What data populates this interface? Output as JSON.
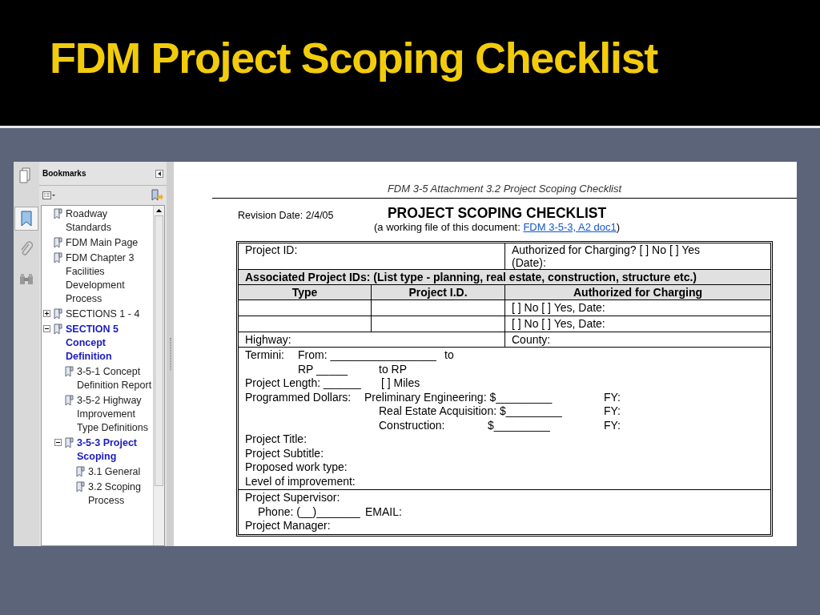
{
  "slide_title": "FDM Project Scoping Checklist",
  "sidebar": {
    "tabs": [
      {
        "kind": "pages",
        "selected": false
      },
      {
        "kind": "bookmarks",
        "selected": true
      },
      {
        "kind": "attachments",
        "selected": false
      },
      {
        "kind": "search",
        "selected": false
      }
    ],
    "panel_title": "Bookmarks",
    "bookmarks": [
      {
        "label": "Roadway Standards",
        "highlighted": false
      },
      {
        "label": "FDM Main Page",
        "highlighted": false
      },
      {
        "label": "FDM Chapter 3 Facilities Development Process",
        "highlighted": false
      },
      {
        "label": "SECTIONS 1 - 4",
        "expanded": false,
        "highlighted": false
      },
      {
        "label": "SECTION 5 Concept Definition",
        "expanded": true,
        "highlighted": true,
        "children": [
          {
            "label": "3-5-1  Concept Definition Report",
            "highlighted": false
          },
          {
            "label": "3-5-2  Highway Improvement Type Definitions",
            "highlighted": false
          },
          {
            "label": "3-5-3  Project Scoping",
            "expanded": true,
            "highlighted": true,
            "children": [
              {
                "label": "3.1  General",
                "highlighted": false
              },
              {
                "label": "3.2  Scoping Process",
                "highlighted": false
              }
            ]
          }
        ]
      }
    ]
  },
  "document": {
    "running_header": "FDM 3-5 Attachment 3.2  Project Scoping Checklist",
    "revision_date": "Revision Date: 2/4/05",
    "title": "PROJECT SCOPING CHECKLIST",
    "subtitle": "(a working file of this document: ",
    "subtitle_link": "FDM 3-5-3, A2 doc1",
    "subtitle_end": ")",
    "table": {
      "project_id": "Project ID:",
      "authorized": "Authorized for Charging? [ ] No  [ ] Yes (Date):",
      "associated_heading": "Associated Project IDs: (List type - planning, real estate, construction, structure etc.)",
      "columns": [
        "Type",
        "Project I.D.",
        "Authorized for Charging"
      ],
      "rows": [
        [
          "",
          "",
          "[ ] No  [ ] Yes, Date:"
        ],
        [
          "",
          "",
          "[ ] No  [ ] Yes, Date:"
        ]
      ],
      "highway": "Highway:",
      "county": "County:",
      "details": [
        [
          "Termini:",
          "From: _________________",
          "to"
        ],
        [
          "RP _____",
          "to RP"
        ],
        [
          "Project Length: ______",
          "[ ] Miles"
        ],
        [
          "Programmed Dollars:",
          "Preliminary Engineering: $_________",
          "FY:"
        ],
        [
          "Real Estate Acquisition: $_________",
          "FY:"
        ],
        [
          "Construction:",
          "$_________",
          "FY:"
        ],
        [
          "Project Title:"
        ],
        [
          "Project Subtitle:"
        ],
        [
          "Proposed work type:"
        ],
        [
          "Level of improvement:"
        ]
      ],
      "contacts": [
        [
          "Project Supervisor:"
        ],
        [
          "Phone: (__)_______",
          "EMAIL:"
        ],
        [
          "Project Manager:"
        ]
      ]
    }
  }
}
